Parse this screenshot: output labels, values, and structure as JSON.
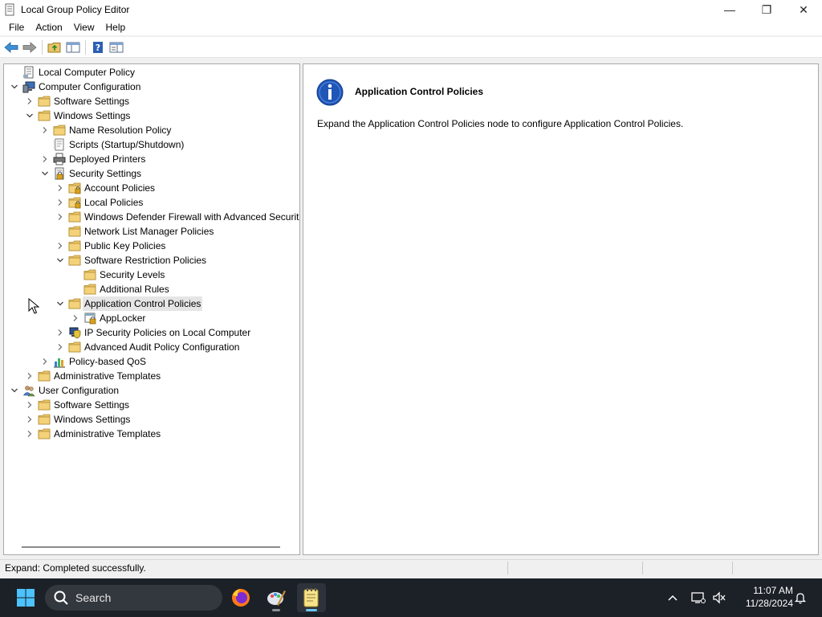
{
  "window": {
    "title": "Local Group Policy Editor",
    "controls": {
      "minimize": "—",
      "maximize": "❐",
      "close": "✕"
    }
  },
  "menu": [
    "File",
    "Action",
    "View",
    "Help"
  ],
  "toolbar": {
    "buttons": [
      "back-arrow-icon",
      "forward-arrow-icon",
      "up-folder-icon",
      "show-hide-tree-icon",
      "help-icon",
      "properties-icon"
    ]
  },
  "tree": [
    {
      "label": "Local Computer Policy",
      "level": 0,
      "expander": "none",
      "icon": "policy-doc-icon"
    },
    {
      "label": "Computer Configuration",
      "level": 0,
      "expander": "expanded",
      "icon": "computer-icon"
    },
    {
      "label": "Software Settings",
      "level": 1,
      "expander": "collapsed",
      "icon": "folder-icon"
    },
    {
      "label": "Windows Settings",
      "level": 1,
      "expander": "expanded",
      "icon": "folder-icon"
    },
    {
      "label": "Name Resolution Policy",
      "level": 2,
      "expander": "collapsed",
      "icon": "folder-icon"
    },
    {
      "label": "Scripts (Startup/Shutdown)",
      "level": 2,
      "expander": "none",
      "icon": "script-icon"
    },
    {
      "label": "Deployed Printers",
      "level": 2,
      "expander": "collapsed",
      "icon": "printer-icon"
    },
    {
      "label": "Security Settings",
      "level": 2,
      "expander": "expanded",
      "icon": "security-icon"
    },
    {
      "label": "Account Policies",
      "level": 3,
      "expander": "collapsed",
      "icon": "locked-folder-icon"
    },
    {
      "label": "Local Policies",
      "level": 3,
      "expander": "collapsed",
      "icon": "locked-folder-icon"
    },
    {
      "label": "Windows Defender Firewall with Advanced Securit",
      "level": 3,
      "expander": "collapsed",
      "icon": "folder-icon"
    },
    {
      "label": "Network List Manager Policies",
      "level": 3,
      "expander": "none",
      "icon": "folder-icon"
    },
    {
      "label": "Public Key Policies",
      "level": 3,
      "expander": "collapsed",
      "icon": "folder-icon"
    },
    {
      "label": "Software Restriction Policies",
      "level": 3,
      "expander": "expanded",
      "icon": "folder-icon"
    },
    {
      "label": "Security Levels",
      "level": 4,
      "expander": "none",
      "icon": "folder-icon"
    },
    {
      "label": "Additional Rules",
      "level": 4,
      "expander": "none",
      "icon": "folder-icon"
    },
    {
      "label": "Application Control Policies",
      "level": 3,
      "expander": "expanded",
      "icon": "folder-icon",
      "selected": true
    },
    {
      "label": "AppLocker",
      "level": 4,
      "expander": "collapsed",
      "icon": "applocker-icon"
    },
    {
      "label": "IP Security Policies on Local Computer",
      "level": 3,
      "expander": "collapsed",
      "icon": "ip-security-icon"
    },
    {
      "label": "Advanced Audit Policy Configuration",
      "level": 3,
      "expander": "collapsed",
      "icon": "folder-icon"
    },
    {
      "label": "Policy-based QoS",
      "level": 2,
      "expander": "collapsed",
      "icon": "qos-chart-icon"
    },
    {
      "label": "Administrative Templates",
      "level": 1,
      "expander": "collapsed",
      "icon": "folder-icon"
    },
    {
      "label": "User Configuration",
      "level": 0,
      "expander": "expanded",
      "icon": "users-icon"
    },
    {
      "label": "Software Settings",
      "level": 1,
      "expander": "collapsed",
      "icon": "folder-icon"
    },
    {
      "label": "Windows Settings",
      "level": 1,
      "expander": "collapsed",
      "icon": "folder-icon"
    },
    {
      "label": "Administrative Templates",
      "level": 1,
      "expander": "collapsed",
      "icon": "folder-icon"
    }
  ],
  "details": {
    "title": "Application Control Policies",
    "description": "Expand the Application Control Policies node to configure Application Control Policies.",
    "icon": "info-icon"
  },
  "status": {
    "text": "Expand:  Completed successfully."
  },
  "taskbar": {
    "search_placeholder": "Search",
    "apps": [
      "firefox-icon",
      "paint-icon",
      "notepad-icon"
    ],
    "active_app": "notepad-icon",
    "time": "11:07 AM",
    "date": "11/28/2024"
  },
  "colors": {
    "folder": "#e9c46a",
    "selection": "#e5e5e5",
    "taskbar": "#1c2027",
    "accent": "#0078d4"
  }
}
